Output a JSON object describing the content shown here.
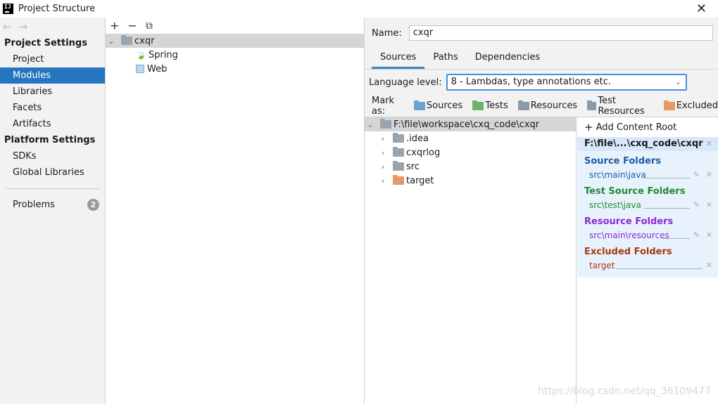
{
  "window": {
    "title": "Project Structure",
    "close": "✕"
  },
  "left": {
    "project_settings": "Project Settings",
    "project_items": [
      "Project",
      "Modules",
      "Libraries",
      "Facets",
      "Artifacts"
    ],
    "platform_settings": "Platform Settings",
    "platform_items": [
      "SDKs",
      "Global Libraries"
    ],
    "problems_label": "Problems",
    "problems_count": "2"
  },
  "mid": {
    "toolbar": {
      "add": "+",
      "remove": "−",
      "copy": "⧉"
    },
    "tree": {
      "module": "cxqr",
      "children": [
        "Spring",
        "Web"
      ]
    }
  },
  "right": {
    "name_label": "Name:",
    "name_value": "cxqr",
    "tabs": [
      "Sources",
      "Paths",
      "Dependencies"
    ],
    "language_level_label": "Language level:",
    "language_level_value": "8 - Lambdas, type annotations etc.",
    "mark_as_label": "Mark as:",
    "mark_as": [
      {
        "label": "Sources",
        "color": "#6aa3cf"
      },
      {
        "label": "Tests",
        "color": "#6bb26b"
      },
      {
        "label": "Resources",
        "color": "#8a9aa8"
      },
      {
        "label": "Test Resources",
        "color": "#8a9aa8"
      },
      {
        "label": "Excluded",
        "color": "#e89767"
      }
    ],
    "content_tree": {
      "root": "F:\\file\\workspace\\cxq_code\\cxqr",
      "folders": [
        {
          "name": ".idea",
          "color": "#9aa4ae"
        },
        {
          "name": "cxqrlog",
          "color": "#9aa4ae"
        },
        {
          "name": "src",
          "color": "#9aa4ae"
        },
        {
          "name": "target",
          "color": "#e89767"
        }
      ]
    },
    "root_pane": {
      "add_content_root": "Add Content Root",
      "root_path": "F:\\file\\...\\cxq_code\\cxqr",
      "groups": [
        {
          "header": "Source Folders",
          "item": "src\\main\\java",
          "color": "#1d5ca3",
          "item_color": "#1d5ca3"
        },
        {
          "header": "Test Source Folders",
          "item": "src\\test\\java",
          "color": "#1f8a2e",
          "item_color": "#1f8a2e"
        },
        {
          "header": "Resource Folders",
          "item": "src\\main\\resources",
          "color": "#8a2bd1",
          "item_color": "#8a2bd1"
        },
        {
          "header": "Excluded Folders",
          "item": "target",
          "color": "#a33b12",
          "item_color": "#a33b12"
        }
      ]
    },
    "watermark": "https://blog.csdn.net/qq_36109477"
  }
}
